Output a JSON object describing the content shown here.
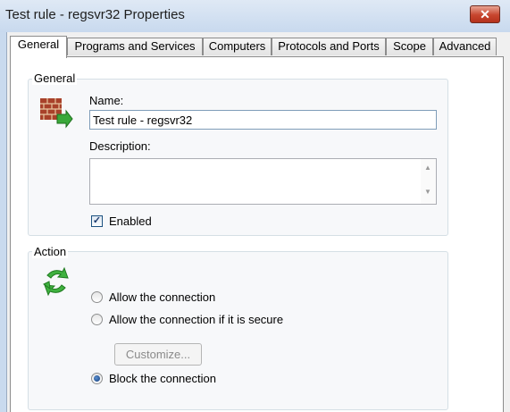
{
  "window": {
    "title": "Test rule - regsvr32 Properties",
    "close_glyph": "✕"
  },
  "tabs": [
    {
      "label": "General",
      "active": true
    },
    {
      "label": "Programs and Services"
    },
    {
      "label": "Computers"
    },
    {
      "label": "Protocols and Ports"
    },
    {
      "label": "Scope"
    },
    {
      "label": "Advanced"
    }
  ],
  "general": {
    "group_title": "General",
    "icon": "firewall-rule-icon",
    "name_label": "Name:",
    "name_value": "Test rule - regsvr32",
    "description_label": "Description:",
    "description_value": "",
    "enabled_label": "Enabled",
    "enabled_checked": true,
    "check_glyph": "✓"
  },
  "action": {
    "group_title": "Action",
    "icon": "action-arrows-icon",
    "options": [
      {
        "label": "Allow the connection",
        "checked": false
      },
      {
        "label": "Allow the connection if it is secure",
        "checked": false
      },
      {
        "label": "Block the connection",
        "checked": true
      }
    ],
    "customize_label": "Customize..."
  },
  "colors": {
    "title_gradient": "#c8d9ee",
    "close_red": "#c7452e",
    "selection_blue": "#3399ff",
    "group_border": "#d5dfe5"
  }
}
